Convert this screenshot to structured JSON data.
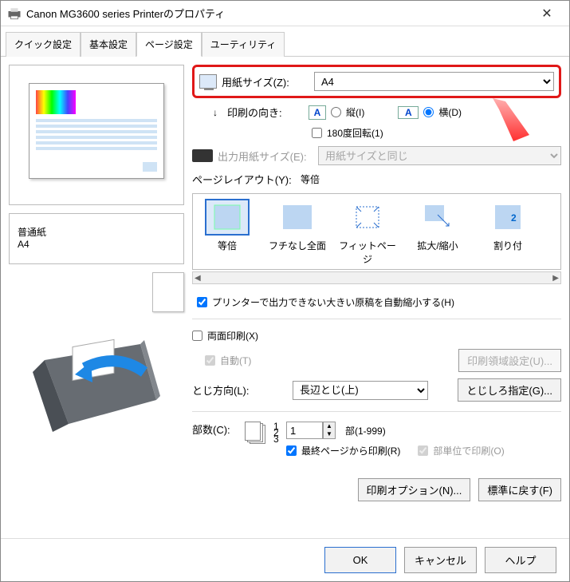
{
  "window": {
    "title": "Canon MG3600 series Printerのプロパティ"
  },
  "tabs": [
    "クイック設定",
    "基本設定",
    "ページ設定",
    "ユーティリティ"
  ],
  "active_tab": 2,
  "preview": {
    "media_type": "普通紙",
    "page_size": "A4"
  },
  "page_size": {
    "label": "用紙サイズ(Z):",
    "value": "A4"
  },
  "orientation": {
    "label": "印刷の向き:",
    "portrait": "縦(I)",
    "landscape": "横(D)",
    "selected": "landscape",
    "rotate180": "180度回転(1)",
    "rotate180_checked": false
  },
  "output_size": {
    "label": "出力用紙サイズ(E):",
    "value": "用紙サイズと同じ"
  },
  "page_layout": {
    "label": "ページレイアウト(Y):",
    "value": "等倍",
    "items": [
      "等倍",
      "フチなし全面",
      "フィットページ",
      "拡大/縮小",
      "割り付"
    ]
  },
  "auto_reduce": {
    "label": "プリンターで出力できない大きい原稿を自動縮小する(H)",
    "checked": true
  },
  "duplex": {
    "label": "両面印刷(X)",
    "checked": false,
    "auto_label": "自動(T)",
    "auto_checked": true,
    "area_btn": "印刷領域設定(U)..."
  },
  "binding": {
    "label": "とじ方向(L):",
    "value": "長辺とじ(上)",
    "margin_btn": "とじしろ指定(G)..."
  },
  "copies": {
    "label": "部数(C):",
    "value": "1",
    "range": "部(1-999)",
    "reverse": "最終ページから印刷(R)",
    "reverse_checked": true,
    "collate": "部単位で印刷(O)",
    "collate_checked": true
  },
  "bottom_btns": {
    "options": "印刷オプション(N)...",
    "defaults": "標準に戻す(F)"
  },
  "footer": {
    "ok": "OK",
    "cancel": "キャンセル",
    "help": "ヘルプ"
  }
}
